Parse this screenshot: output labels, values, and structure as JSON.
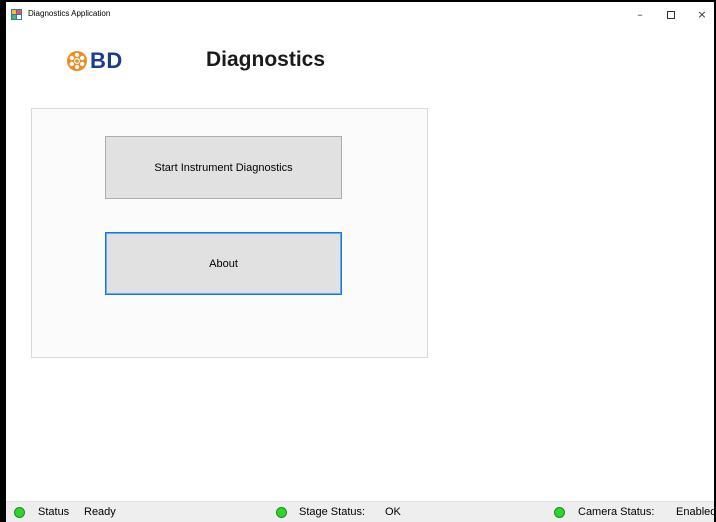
{
  "window": {
    "title": "Diagnostics Application",
    "controls": {
      "minimize": "–",
      "maximize": "□",
      "close": "×"
    }
  },
  "header": {
    "logo_text": "BD",
    "title": "Diagnostics"
  },
  "panel": {
    "start_button": "Start Instrument Diagnostics",
    "about_button": "About"
  },
  "statusbar": {
    "status_label": "Status",
    "status_value": "Ready",
    "stage_label": "Stage Status:",
    "stage_value": "OK",
    "camera_label": "Camera Status:",
    "camera_value": "Enabled"
  },
  "colors": {
    "brand": "#1b3c8f",
    "logo_orange": "#f08a1c",
    "status_ok": "#2dd52d",
    "focus_border": "#1b77d6"
  }
}
